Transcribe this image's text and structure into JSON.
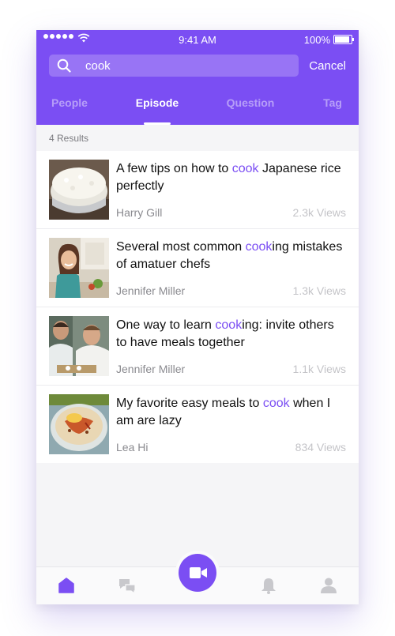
{
  "status_bar": {
    "time": "9:41 AM",
    "battery": "100%",
    "battery_level": 1.0
  },
  "search": {
    "query": "cook",
    "cancel_label": "Cancel"
  },
  "tabs": [
    {
      "label": "People",
      "active": false
    },
    {
      "label": "Episode",
      "active": true
    },
    {
      "label": "Question",
      "active": false
    },
    {
      "label": "Tag",
      "active": false
    }
  ],
  "results_count": "4 Results",
  "results": [
    {
      "title_before": "A few tips on how to ",
      "title_hl": "cook",
      "title_after": " Japanese rice perfectly",
      "author": "Harry Gill",
      "views": "2.3k Views",
      "thumb": "rice-bowl-photo"
    },
    {
      "title_before": "Several most common ",
      "title_hl": "cook",
      "title_after": "ing mistakes of amatuer chefs",
      "author": "Jennifer Miller",
      "views": "1.3k Views",
      "thumb": "woman-kitchen-photo"
    },
    {
      "title_before": "One way to learn ",
      "title_hl": "cook",
      "title_after": "ing: invite others to have meals together",
      "author": "Jennifer Miller",
      "views": "1.1k Views",
      "thumb": "chefs-cooking-photo"
    },
    {
      "title_before": "My favorite easy meals to ",
      "title_hl": "cook",
      "title_after": " when I am are lazy",
      "author": "Lea Hi",
      "views": "834 Views",
      "thumb": "hummus-bowl-photo"
    }
  ],
  "tab_bar": {
    "items": [
      "home-icon",
      "chat-icon",
      "video-camera-icon",
      "bell-icon",
      "profile-icon"
    ],
    "active": "home-icon"
  },
  "colors": {
    "accent": "#7b4ef3",
    "inactive_icon": "#c8c8cc"
  }
}
